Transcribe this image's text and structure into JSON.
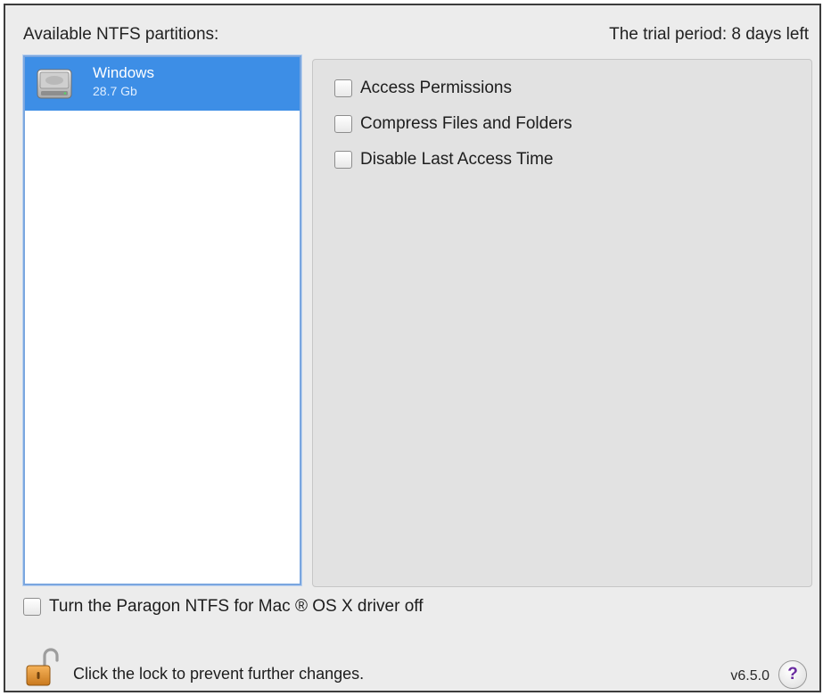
{
  "header": {
    "partitions_label": "Available NTFS partitions:",
    "trial_label": "The trial period: 8 days left"
  },
  "partitions": [
    {
      "name": "Windows",
      "size": "28.7 Gb",
      "icon": "hard-disk-icon",
      "selected": true
    }
  ],
  "options": [
    {
      "label": "Access Permissions",
      "checked": false
    },
    {
      "label": "Compress Files and Folders",
      "checked": false
    },
    {
      "label": "Disable Last Access Time",
      "checked": false
    }
  ],
  "driver_toggle": {
    "label": "Turn the Paragon NTFS for Mac ® OS X driver off",
    "checked": false
  },
  "footer": {
    "lock_text": "Click the lock to prevent further changes.",
    "lock_icon": "unlocked-padlock-icon",
    "version": "v6.5.0",
    "help_label": "?"
  },
  "colors": {
    "selection": "#3d8ee6",
    "panel": "#e2e2e2",
    "window": "#ececec",
    "help_glyph": "#6a2ba0"
  }
}
